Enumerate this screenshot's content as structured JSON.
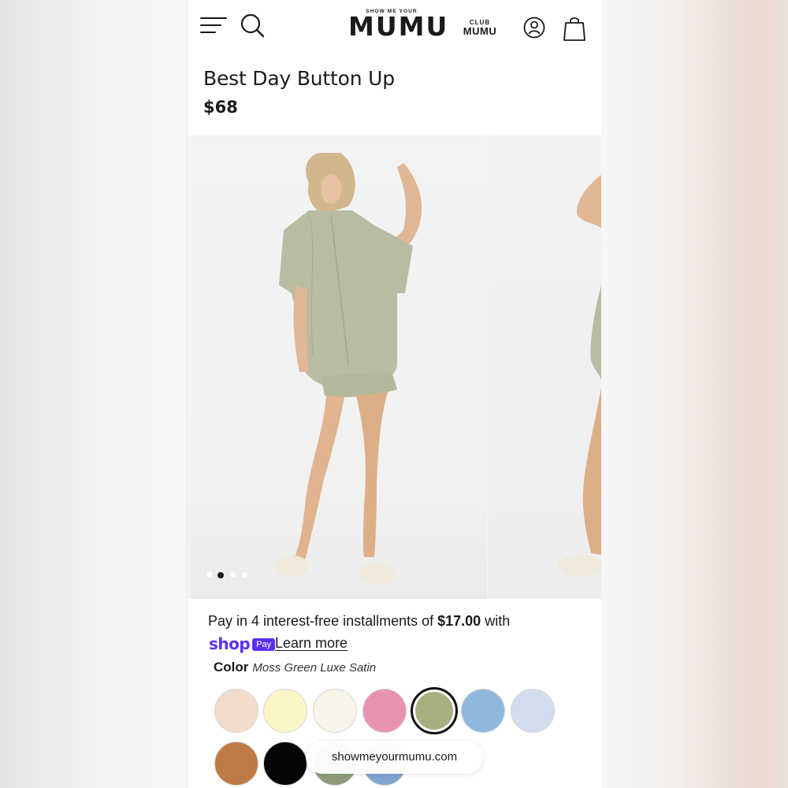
{
  "header": {
    "logo_small": "SHOW ME YOUR",
    "logo_big": "MUMU",
    "club_top": "CLUB",
    "club_bottom": "MUMU",
    "icons": [
      "menu-icon",
      "search-icon",
      "account-icon",
      "bag-icon"
    ]
  },
  "product": {
    "title": "Best Day Button Up",
    "price": "$68"
  },
  "gallery": {
    "slide_count": 4,
    "active_slide": 2
  },
  "installments": {
    "prefix": "Pay in 4 interest-free installments of ",
    "amount": "$17.00",
    "suffix": " with",
    "shop_word": "shop",
    "pay_badge": "Pay",
    "learn_more": "Learn more"
  },
  "color": {
    "label": "Color",
    "selected_name": "Moss Green Luxe Satin",
    "swatches": [
      {
        "name": "swatch-blush",
        "color": "#f2dccb",
        "selected": false
      },
      {
        "name": "swatch-butter",
        "color": "#fbf6c6",
        "selected": false
      },
      {
        "name": "swatch-ivory",
        "color": "#f8f5e8",
        "selected": false
      },
      {
        "name": "swatch-pink",
        "color": "#e893b0",
        "selected": false
      },
      {
        "name": "swatch-moss-green",
        "color": "#a7af7e",
        "selected": true
      },
      {
        "name": "swatch-sky-blue",
        "color": "#8fb9dc",
        "selected": false
      },
      {
        "name": "swatch-lavender",
        "color": "#d3dbee",
        "selected": false
      },
      {
        "name": "swatch-copper",
        "color": "#c07a45",
        "selected": false
      },
      {
        "name": "swatch-black",
        "color": "#050505",
        "selected": false
      },
      {
        "name": "swatch-print-green",
        "color": "#8f9c7c",
        "selected": false
      },
      {
        "name": "swatch-print-blue",
        "color": "#7ea4cf",
        "selected": false
      }
    ]
  },
  "browser": {
    "url": "showmeyourmumu.com"
  }
}
